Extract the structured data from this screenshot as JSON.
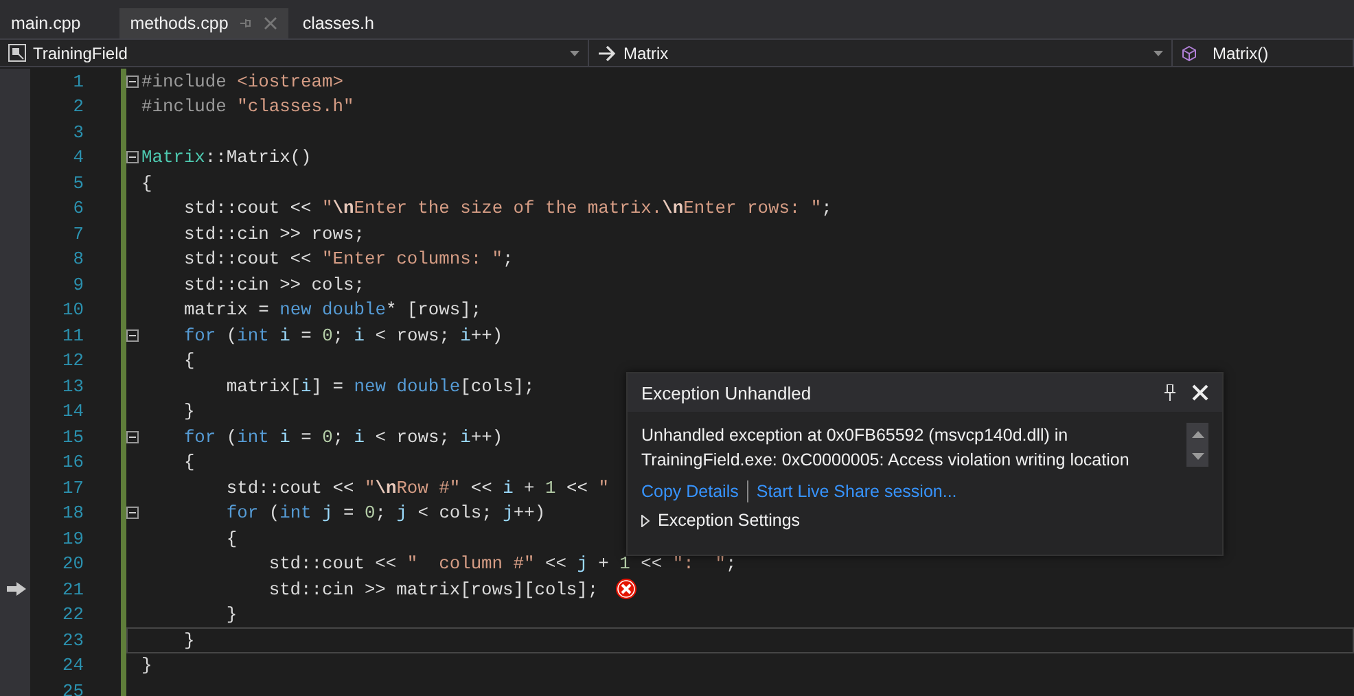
{
  "tabs": [
    {
      "label": "main.cpp",
      "selected": false
    },
    {
      "label": "methods.cpp",
      "selected": true
    },
    {
      "label": "classes.h",
      "selected": false
    }
  ],
  "nav_bar": {
    "project": "TrainingField",
    "scope": "Matrix",
    "member": "Matrix()"
  },
  "code_lines": [
    {
      "number": "1",
      "fold": true,
      "current": false,
      "execution": false,
      "error": false,
      "tokens": [
        {
          "kind": "pre",
          "text": "#include "
        },
        {
          "kind": "str",
          "text": "<iostream>"
        }
      ]
    },
    {
      "number": "2",
      "fold": false,
      "current": false,
      "execution": false,
      "error": false,
      "tokens": [
        {
          "kind": "pre",
          "text": "#include "
        },
        {
          "kind": "str",
          "text": "\"classes.h\""
        }
      ]
    },
    {
      "number": "3",
      "fold": false,
      "current": false,
      "execution": false,
      "error": false
    },
    {
      "number": "4",
      "fold": true,
      "current": false,
      "execution": false,
      "error": false,
      "tokens": [
        {
          "kind": "type",
          "text": "Matrix"
        },
        {
          "kind": "plain",
          "text": "::Matrix()"
        }
      ]
    },
    {
      "number": "5",
      "fold": false,
      "current": false,
      "execution": false,
      "error": false,
      "tokens": [
        {
          "kind": "plain",
          "text": "{"
        }
      ]
    },
    {
      "number": "6",
      "fold": false,
      "current": false,
      "execution": false,
      "error": false,
      "tokens": [
        {
          "kind": "plain",
          "text": "    std::cout << "
        },
        {
          "kind": "str",
          "text": "\""
        },
        {
          "kind": "esc",
          "text": "\\n"
        },
        {
          "kind": "str",
          "text": "Enter the size of the matrix."
        },
        {
          "kind": "esc",
          "text": "\\n"
        },
        {
          "kind": "str",
          "text": "Enter rows: \""
        },
        {
          "kind": "plain",
          "text": ";"
        }
      ]
    },
    {
      "number": "7",
      "fold": false,
      "current": false,
      "execution": false,
      "error": false,
      "tokens": [
        {
          "kind": "plain",
          "text": "    std::cin >> rows;"
        }
      ]
    },
    {
      "number": "8",
      "fold": false,
      "current": false,
      "execution": false,
      "error": false,
      "tokens": [
        {
          "kind": "plain",
          "text": "    std::cout << "
        },
        {
          "kind": "str",
          "text": "\"Enter columns: \""
        },
        {
          "kind": "plain",
          "text": ";"
        }
      ]
    },
    {
      "number": "9",
      "fold": false,
      "current": false,
      "execution": false,
      "error": false,
      "tokens": [
        {
          "kind": "plain",
          "text": "    std::cin >> cols;"
        }
      ]
    },
    {
      "number": "10",
      "fold": false,
      "current": false,
      "execution": false,
      "error": false,
      "tokens": [
        {
          "kind": "plain",
          "text": "    matrix = "
        },
        {
          "kind": "kw",
          "text": "new "
        },
        {
          "kind": "kw",
          "text": "double"
        },
        {
          "kind": "plain",
          "text": "* [rows];"
        }
      ]
    },
    {
      "number": "11",
      "fold": true,
      "current": false,
      "execution": false,
      "error": false,
      "tokens": [
        {
          "kind": "kw",
          "text": "    for"
        },
        {
          "kind": "plain",
          "text": " ("
        },
        {
          "kind": "kw",
          "text": "int "
        },
        {
          "kind": "var",
          "text": "i"
        },
        {
          "kind": "plain",
          "text": " = "
        },
        {
          "kind": "num",
          "text": "0"
        },
        {
          "kind": "plain",
          "text": "; "
        },
        {
          "kind": "var",
          "text": "i"
        },
        {
          "kind": "plain",
          "text": " < rows; "
        },
        {
          "kind": "var",
          "text": "i"
        },
        {
          "kind": "plain",
          "text": "++)"
        }
      ]
    },
    {
      "number": "12",
      "fold": false,
      "current": false,
      "execution": false,
      "error": false,
      "tokens": [
        {
          "kind": "plain",
          "text": "    {"
        }
      ]
    },
    {
      "number": "13",
      "fold": false,
      "current": false,
      "execution": false,
      "error": false,
      "tokens": [
        {
          "kind": "plain",
          "text": "        matrix["
        },
        {
          "kind": "var",
          "text": "i"
        },
        {
          "kind": "plain",
          "text": "] = "
        },
        {
          "kind": "kw",
          "text": "new "
        },
        {
          "kind": "kw",
          "text": "double"
        },
        {
          "kind": "plain",
          "text": "[cols];"
        }
      ]
    },
    {
      "number": "14",
      "fold": false,
      "current": false,
      "execution": false,
      "error": false,
      "tokens": [
        {
          "kind": "plain",
          "text": "    }"
        }
      ]
    },
    {
      "number": "15",
      "fold": true,
      "current": false,
      "execution": false,
      "error": false,
      "tokens": [
        {
          "kind": "kw",
          "text": "    for"
        },
        {
          "kind": "plain",
          "text": " ("
        },
        {
          "kind": "kw",
          "text": "int "
        },
        {
          "kind": "var",
          "text": "i"
        },
        {
          "kind": "plain",
          "text": " = "
        },
        {
          "kind": "num",
          "text": "0"
        },
        {
          "kind": "plain",
          "text": "; "
        },
        {
          "kind": "var",
          "text": "i"
        },
        {
          "kind": "plain",
          "text": " < rows; "
        },
        {
          "kind": "var",
          "text": "i"
        },
        {
          "kind": "plain",
          "text": "++)"
        }
      ]
    },
    {
      "number": "16",
      "fold": false,
      "current": false,
      "execution": false,
      "error": false,
      "tokens": [
        {
          "kind": "plain",
          "text": "    {"
        }
      ]
    },
    {
      "number": "17",
      "fold": false,
      "current": false,
      "execution": false,
      "error": false,
      "tokens": [
        {
          "kind": "plain",
          "text": "        std::cout << "
        },
        {
          "kind": "str",
          "text": "\""
        },
        {
          "kind": "esc",
          "text": "\\n"
        },
        {
          "kind": "str",
          "text": "Row #\""
        },
        {
          "kind": "plain",
          "text": " << "
        },
        {
          "kind": "var",
          "text": "i"
        },
        {
          "kind": "plain",
          "text": " + "
        },
        {
          "kind": "num",
          "text": "1"
        },
        {
          "kind": "plain",
          "text": " << "
        },
        {
          "kind": "str",
          "text": "\""
        }
      ]
    },
    {
      "number": "18",
      "fold": true,
      "current": false,
      "execution": false,
      "error": false,
      "tokens": [
        {
          "kind": "kw",
          "text": "        for"
        },
        {
          "kind": "plain",
          "text": " ("
        },
        {
          "kind": "kw",
          "text": "int "
        },
        {
          "kind": "var",
          "text": "j"
        },
        {
          "kind": "plain",
          "text": " = "
        },
        {
          "kind": "num",
          "text": "0"
        },
        {
          "kind": "plain",
          "text": "; "
        },
        {
          "kind": "var",
          "text": "j"
        },
        {
          "kind": "plain",
          "text": " < cols; "
        },
        {
          "kind": "var",
          "text": "j"
        },
        {
          "kind": "plain",
          "text": "++)"
        }
      ]
    },
    {
      "number": "19",
      "fold": false,
      "current": false,
      "execution": false,
      "error": false,
      "tokens": [
        {
          "kind": "plain",
          "text": "        {"
        }
      ]
    },
    {
      "number": "20",
      "fold": false,
      "current": false,
      "execution": false,
      "error": false,
      "tokens": [
        {
          "kind": "plain",
          "text": "            std::cout << "
        },
        {
          "kind": "str",
          "text": "\"  column #\""
        },
        {
          "kind": "plain",
          "text": " << "
        },
        {
          "kind": "var",
          "text": "j"
        },
        {
          "kind": "plain",
          "text": " + "
        },
        {
          "kind": "num",
          "text": "1"
        },
        {
          "kind": "plain",
          "text": " << "
        },
        {
          "kind": "str",
          "text": "\":  \""
        },
        {
          "kind": "plain",
          "text": ";"
        }
      ]
    },
    {
      "number": "21",
      "fold": false,
      "current": false,
      "execution": true,
      "error": true,
      "tokens": [
        {
          "kind": "plain",
          "text": "            std::cin >> matrix[rows][cols];"
        }
      ]
    },
    {
      "number": "22",
      "fold": false,
      "current": false,
      "execution": false,
      "error": false,
      "tokens": [
        {
          "kind": "plain",
          "text": "        }"
        }
      ]
    },
    {
      "number": "23",
      "fold": false,
      "current": true,
      "execution": false,
      "error": false,
      "tokens": [
        {
          "kind": "plain",
          "text": "    }"
        }
      ]
    },
    {
      "number": "24",
      "fold": false,
      "current": false,
      "execution": false,
      "error": false,
      "tokens": [
        {
          "kind": "plain",
          "text": "}"
        }
      ]
    },
    {
      "number": "25",
      "fold": false,
      "current": false,
      "execution": false,
      "error": false
    }
  ],
  "exception_popup": {
    "title": "Exception Unhandled",
    "message": "Unhandled exception at 0x0FB65592 (msvcp140d.dll) in TrainingField.exe: 0xC0000005: Access violation writing location",
    "links": [
      "Copy Details",
      "Start Live Share session..."
    ],
    "settings": {
      "label": "Exception Settings",
      "expanded": false
    }
  }
}
